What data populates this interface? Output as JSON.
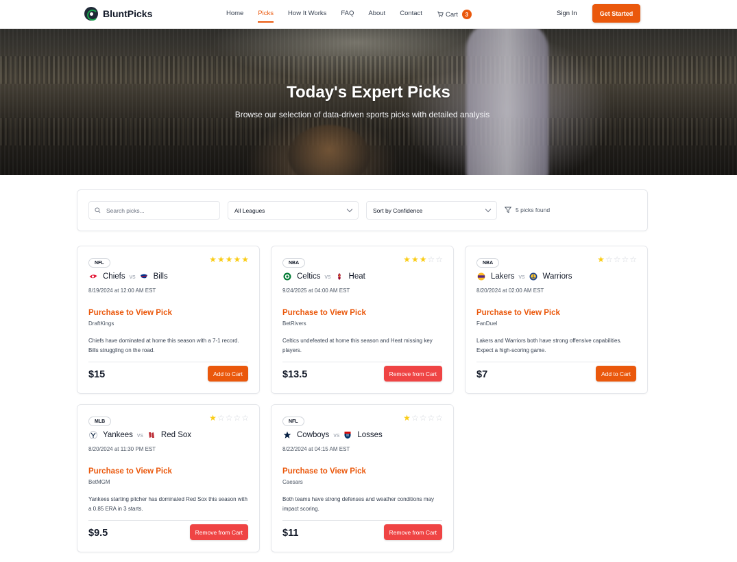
{
  "brand": {
    "name": "BluntPicks"
  },
  "nav": {
    "links": [
      "Home",
      "Picks",
      "How It Works",
      "FAQ",
      "About",
      "Contact"
    ],
    "active": "Picks",
    "cart_label": "Cart",
    "cart_count": "3",
    "signin": "Sign In",
    "cta": "Get Started"
  },
  "hero": {
    "title": "Today's Expert Picks",
    "subtitle": "Browse our selection of data-driven sports picks with detailed analysis"
  },
  "filters": {
    "search_placeholder": "Search picks...",
    "league": "All Leagues",
    "sort": "Sort by Confidence",
    "found": "5 picks found"
  },
  "vs_label": "vs",
  "purchase_label": "Purchase to View Pick",
  "colors": {
    "accent": "#ea580c",
    "remove": "#ef4444",
    "star": "#facc15"
  },
  "picks": [
    {
      "league": "NFL",
      "rating": 5,
      "team1": "Chiefs",
      "team1_icon": "chiefs-logo-icon",
      "team2": "Bills",
      "team2_icon": "bills-logo-icon",
      "date": "8/19/2024 at 12:00 AM EST",
      "book": "DraftKings",
      "desc": "Chiefs have dominated at home this season with a 7-1 record. Bills struggling on the road.",
      "price": "$15",
      "action": "Add to Cart"
    },
    {
      "league": "NBA",
      "rating": 3,
      "team1": "Celtics",
      "team1_icon": "celtics-logo-icon",
      "team2": "Heat",
      "team2_icon": "heat-logo-icon",
      "date": "9/24/2025 at 04:00 AM EST",
      "book": "BetRivers",
      "desc": "Celtics undefeated at home this season and Heat missing key players.",
      "price": "$13.5",
      "action": "Remove from Cart"
    },
    {
      "league": "NBA",
      "rating": 1,
      "team1": "Lakers",
      "team1_icon": "lakers-logo-icon",
      "team2": "Warriors",
      "team2_icon": "warriors-logo-icon",
      "date": "8/20/2024 at 02:00 AM EST",
      "book": "FanDuel",
      "desc": "Lakers and Warriors both have strong offensive capabilities. Expect a high-scoring game.",
      "price": "$7",
      "action": "Add to Cart"
    },
    {
      "league": "MLB",
      "rating": 1,
      "team1": "Yankees",
      "team1_icon": "yankees-logo-icon",
      "team2": "Red Sox",
      "team2_icon": "red-sox-logo-icon",
      "date": "8/20/2024 at 11:30 PM EST",
      "book": "BetMGM",
      "desc": "Yankees starting pitcher has dominated Red Sox this season with a 0.85 ERA in 3 starts.",
      "price": "$9.5",
      "action": "Remove from Cart"
    },
    {
      "league": "NFL",
      "rating": 1,
      "team1": "Cowboys",
      "team1_icon": "cowboys-logo-icon",
      "team2": "Losses",
      "team2_icon": "nfl-shield-icon",
      "date": "8/22/2024 at 04:15 AM EST",
      "book": "Caesars",
      "desc": "Both teams have strong defenses and weather conditions may impact scoring.",
      "price": "$11",
      "action": "Remove from Cart"
    }
  ]
}
